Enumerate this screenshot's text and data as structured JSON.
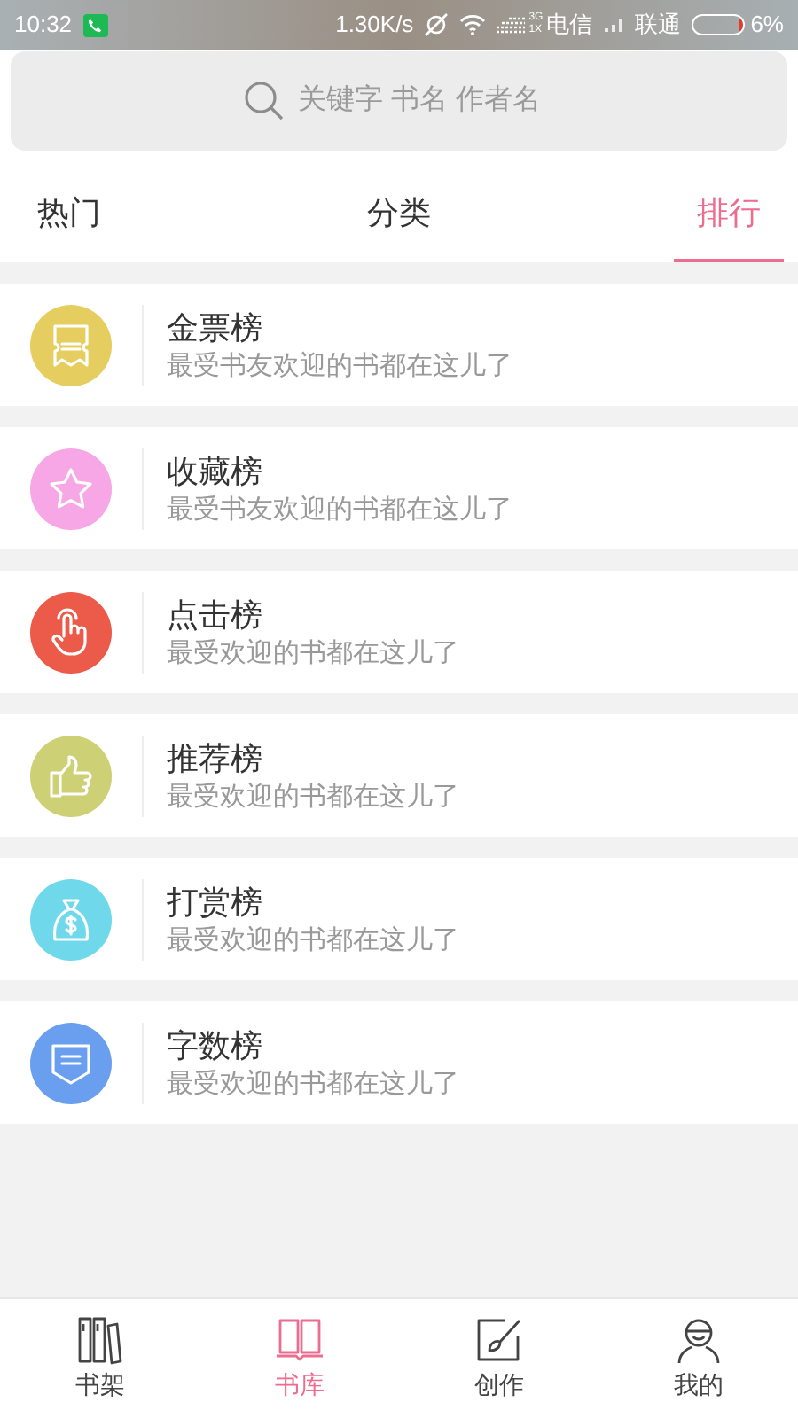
{
  "status_bar": {
    "time": "10:32",
    "speed": "1.30K/s",
    "net_label": "3G",
    "net_sub": "1X",
    "carrier_1": "电信",
    "carrier_2": "联通",
    "battery": {
      "reading": "6%",
      "level": 0.06
    }
  },
  "search": {
    "placeholder": "关键字 书名 作者名"
  },
  "tabs": [
    {
      "label": "热门",
      "selected": false
    },
    {
      "label": "分类",
      "selected": false
    },
    {
      "label": "排行",
      "selected": true
    }
  ],
  "rankings": [
    {
      "kind": "ticket",
      "color": "#e6cd5f",
      "title": "金票榜",
      "subtitle": "最受书友欢迎的书都在这儿了"
    },
    {
      "kind": "star",
      "color": "#f7a6e6",
      "title": "收藏榜",
      "subtitle": "最受书友欢迎的书都在这儿了"
    },
    {
      "kind": "hand",
      "color": "#ec5a4a",
      "title": "点击榜",
      "subtitle": "最受欢迎的书都在这儿了"
    },
    {
      "kind": "thumb",
      "color": "#cdd074",
      "title": "推荐榜",
      "subtitle": "最受欢迎的书都在这儿了"
    },
    {
      "kind": "bag",
      "color": "#6fd9eb",
      "title": "打赏榜",
      "subtitle": "最受欢迎的书都在这儿了"
    },
    {
      "kind": "badge",
      "color": "#6a9ff0",
      "title": "字数榜",
      "subtitle": "最受欢迎的书都在这儿了"
    }
  ],
  "bottom_nav": [
    {
      "kind": "shelf",
      "label": "书架",
      "selected": false
    },
    {
      "kind": "book",
      "label": "书库",
      "selected": true
    },
    {
      "kind": "brush",
      "label": "创作",
      "selected": false
    },
    {
      "kind": "person",
      "label": "我的",
      "selected": false
    }
  ]
}
